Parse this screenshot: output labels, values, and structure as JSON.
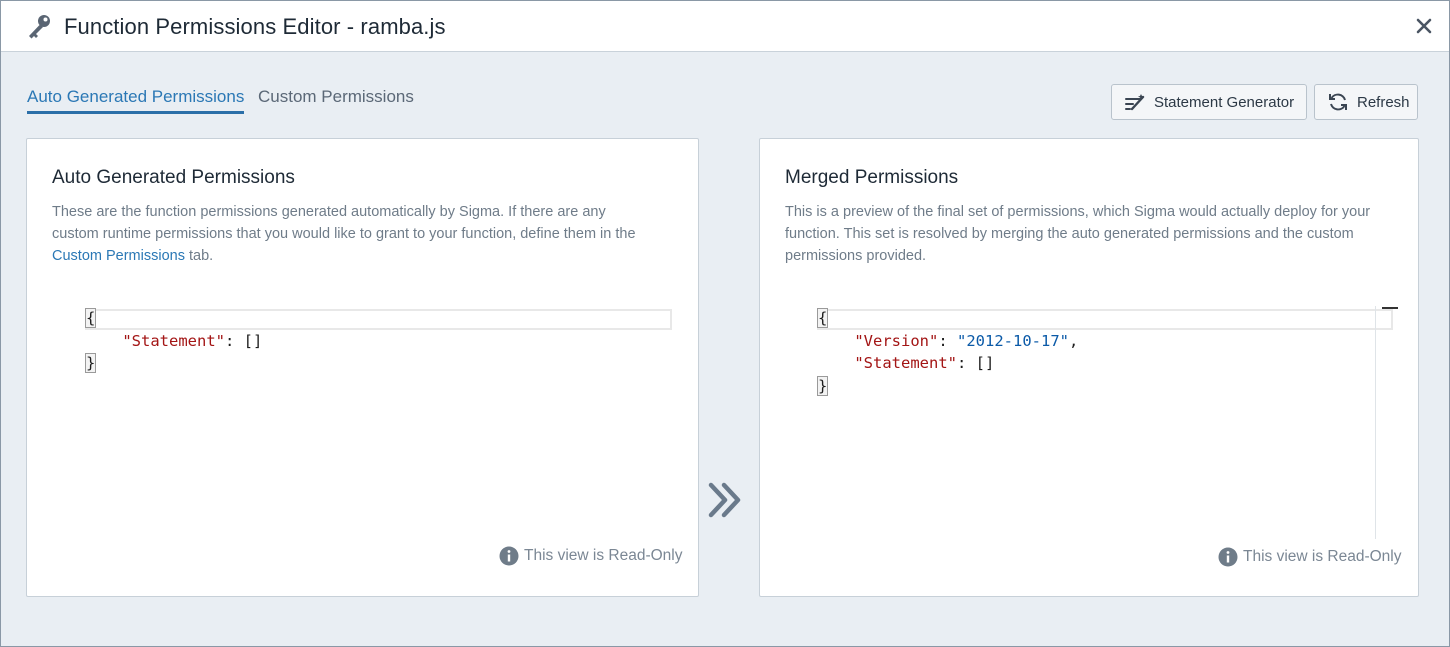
{
  "window": {
    "title": "Function Permissions Editor - ramba.js",
    "icons": {
      "title": "key-icon",
      "close": "close-icon"
    }
  },
  "tabs": [
    {
      "label": "Auto Generated Permissions",
      "active": true
    },
    {
      "label": "Custom Permissions",
      "active": false
    }
  ],
  "toolbar": {
    "statement_generator_label": "Statement Generator",
    "refresh_label": "Refresh"
  },
  "auto_panel": {
    "title": "Auto Generated Permissions",
    "desc_1": "These are the function permissions generated automatically by Sigma. If there are any",
    "desc_2": "custom runtime permissions that you would like to grant to your function, define them in the",
    "desc_link": "Custom Permissions",
    "desc_3": " tab.",
    "code": {
      "open": "{",
      "statement_key": "\"Statement\"",
      "statement_rest": ": []",
      "close": "}"
    },
    "readonly_label": "This view is Read-Only"
  },
  "merged_panel": {
    "title": "Merged Permissions",
    "desc_1": "This is a preview of the final set of permissions, which Sigma would actually deploy for your",
    "desc_2": "function. This set is resolved by merging the auto generated permissions and the custom",
    "desc_3": "permissions provided.",
    "code": {
      "open": "{",
      "version_key": "\"Version\"",
      "version_sep": ": ",
      "version_value": "\"2012-10-17\"",
      "version_tail": ",",
      "statement_key": "\"Statement\"",
      "statement_rest": ": []",
      "close": "}"
    },
    "readonly_label": "This view is Read-Only"
  },
  "colors": {
    "accent": "#2b78b5",
    "json_key": "#a31515",
    "json_string": "#0b5aa8",
    "background": "#e9eef3"
  }
}
